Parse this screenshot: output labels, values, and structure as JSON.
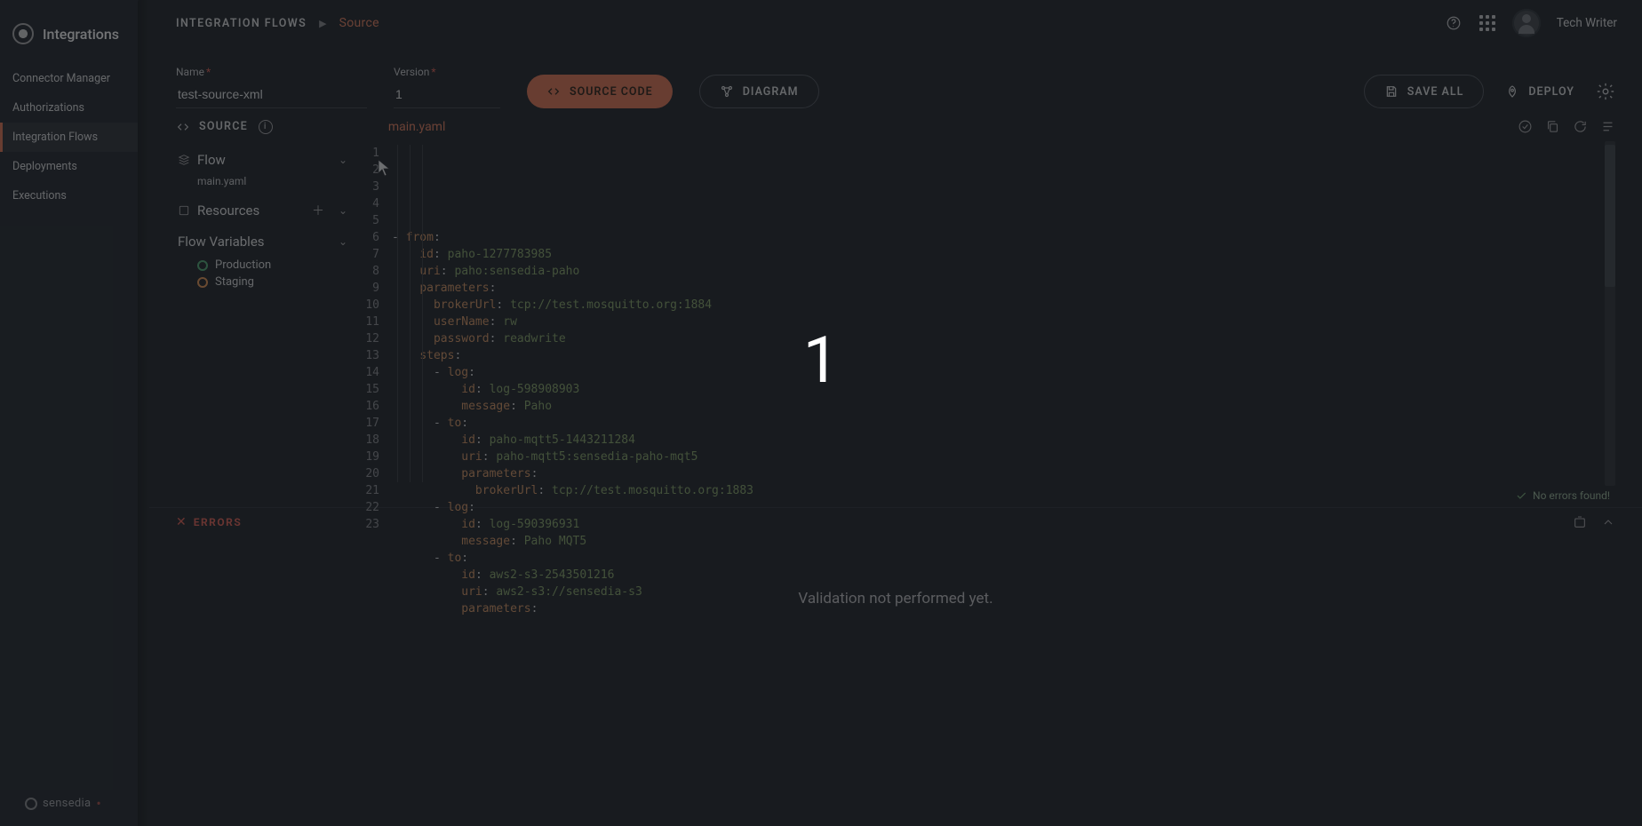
{
  "brand": "Integrations",
  "sidebar": {
    "items": [
      {
        "label": "Connector Manager"
      },
      {
        "label": "Authorizations"
      },
      {
        "label": "Integration Flows",
        "active": true
      },
      {
        "label": "Deployments"
      },
      {
        "label": "Executions"
      }
    ],
    "footer": "sensedia"
  },
  "breadcrumb": {
    "root": "INTEGRATION FLOWS",
    "current": "Source"
  },
  "user": {
    "name": "Tech Writer"
  },
  "form": {
    "name_label": "Name",
    "name_value": "test-source-xml",
    "version_label": "Version",
    "version_value": "1",
    "source_code": "SOURCE CODE",
    "diagram": "DIAGRAM",
    "save_all": "SAVE ALL",
    "deploy": "DEPLOY"
  },
  "source_section": {
    "label": "SOURCE",
    "tab": "main.yaml"
  },
  "tree": {
    "flow": "Flow",
    "flow_child": "main.yaml",
    "resources": "Resources",
    "flow_vars": "Flow Variables",
    "env_prod": "Production",
    "env_stage": "Staging"
  },
  "code_lines": [
    "- <k>from</k><p>:</p>",
    "    <k>id</k><p>:</p> <v>paho-1277783985</v>",
    "    <k>uri</k><p>:</p> <v>paho:sensedia-paho</v>",
    "    <k>parameters</k><p>:</p>",
    "      <k>brokerUrl</k><p>:</p> <v>tcp://test.mosquitto.org:1884</v>",
    "      <k>userName</k><p>:</p> <v>rw</v>",
    "      <k>password</k><p>:</p> <v>readwrite</v>",
    "    <k>steps</k><p>:</p>",
    "      <d>-</d> <k>log</k><p>:</p>",
    "          <k>id</k><p>:</p> <v>log-598908903</v>",
    "          <k>message</k><p>:</p> <v>Paho</v>",
    "      <d>-</d> <k>to</k><p>:</p>",
    "          <k>id</k><p>:</p> <v>paho-mqtt5-1443211284</v>",
    "          <k>uri</k><p>:</p> <v>paho-mqtt5:sensedia-paho-mqt5</v>",
    "          <k>parameters</k><p>:</p>",
    "            <k>brokerUrl</k><p>:</p> <v>tcp://test.mosquitto.org:1883</v>",
    "      <d>-</d> <k>log</k><p>:</p>",
    "          <k>id</k><p>:</p> <v>log-590396931</v>",
    "          <k>message</k><p>:</p> <v>Paho MQT5</v>",
    "      <d>-</d> <k>to</k><p>:</p>",
    "          <k>id</k><p>:</p> <v>aws2-s3-2543501216</v>",
    "          <k>uri</k><p>:</p> <v>aws2-s3://sensedia-s3</v>",
    "          <k>parameters</k><p>:</p>"
  ],
  "status": "No errors found!",
  "errors": {
    "label": "ERRORS",
    "body": "Validation not performed yet."
  },
  "overlay_number": "1"
}
